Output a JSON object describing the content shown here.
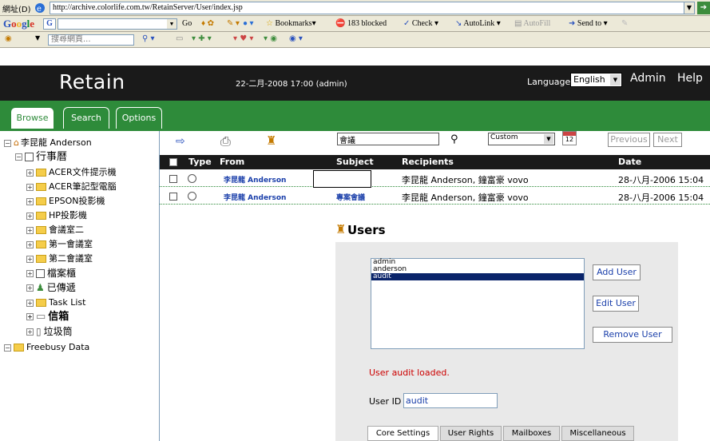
{
  "browser": {
    "address_label": "網址(D)",
    "url": "http://archive.colorlife.com.tw/RetainServer/User/index.jsp",
    "google_logo": [
      "G",
      "o",
      "o",
      "g",
      "l",
      "e"
    ],
    "google_button": "G",
    "toolbar_items": {
      "go": "Go",
      "bookmarks": "Bookmarks",
      "blocked": "183 blocked",
      "check": "Check",
      "autolink": "AutoLink",
      "autofill": "AutoFill",
      "sendto": "Send to"
    },
    "search_placeholder": "搜尋網頁..."
  },
  "header": {
    "logo": "Retain",
    "datetime": "22-二月-2008 17:00 (admin)",
    "language_label": "Language",
    "language_value": "English",
    "admin_link": "Admin",
    "help_link": "Help"
  },
  "tabs": [
    "Browse",
    "Search",
    "Options"
  ],
  "tree": {
    "root": "李昆龍 Anderson",
    "calendar": "行事曆",
    "calendar_children": [
      "ACER文件提示機",
      "ACER筆記型電腦",
      "EPSON投影機",
      "HP投影機",
      "會議室二",
      "第一會議室",
      "第二會議室"
    ],
    "other": [
      "檔案櫃",
      "已傳遞",
      "Task List",
      "信箱",
      "垃圾筒"
    ],
    "freebusy": "Freebusy Data"
  },
  "toolbar": {
    "search_value": "會議",
    "date_filter": "Custom",
    "cal_day": "12",
    "previous": "Previous",
    "next": "Next"
  },
  "columns": [
    "Type",
    "From",
    "Subject",
    "Recipients",
    "Date"
  ],
  "rows": [
    {
      "from": "李昆龍 Anderson",
      "subject": "",
      "recipients": "李昆龍 Anderson, 鐘富豪 vovo",
      "date": "28-八月-2006 15:04"
    },
    {
      "from": "李昆龍 Anderson",
      "subject": "專案會議",
      "recipients": "李昆龍 Anderson, 鐘富豪 vovo",
      "date": "28-八月-2006 15:04"
    }
  ],
  "users_panel": {
    "title": "Users",
    "user_list": [
      "admin",
      "anderson",
      "audit"
    ],
    "selected_user": "audit",
    "add_user": "Add User",
    "edit_user": "Edit User",
    "remove_user": "Remove User",
    "status_message": "User audit loaded.",
    "user_id_label": "User ID",
    "user_id_value": "audit",
    "subtabs": [
      "Core Settings",
      "User Rights",
      "Mailboxes",
      "Miscellaneous"
    ]
  },
  "colors": {
    "green": "#2e8b3a",
    "black": "#1a1a1a",
    "status_red": "#cc0000",
    "link_blue": "#1a3faa"
  }
}
